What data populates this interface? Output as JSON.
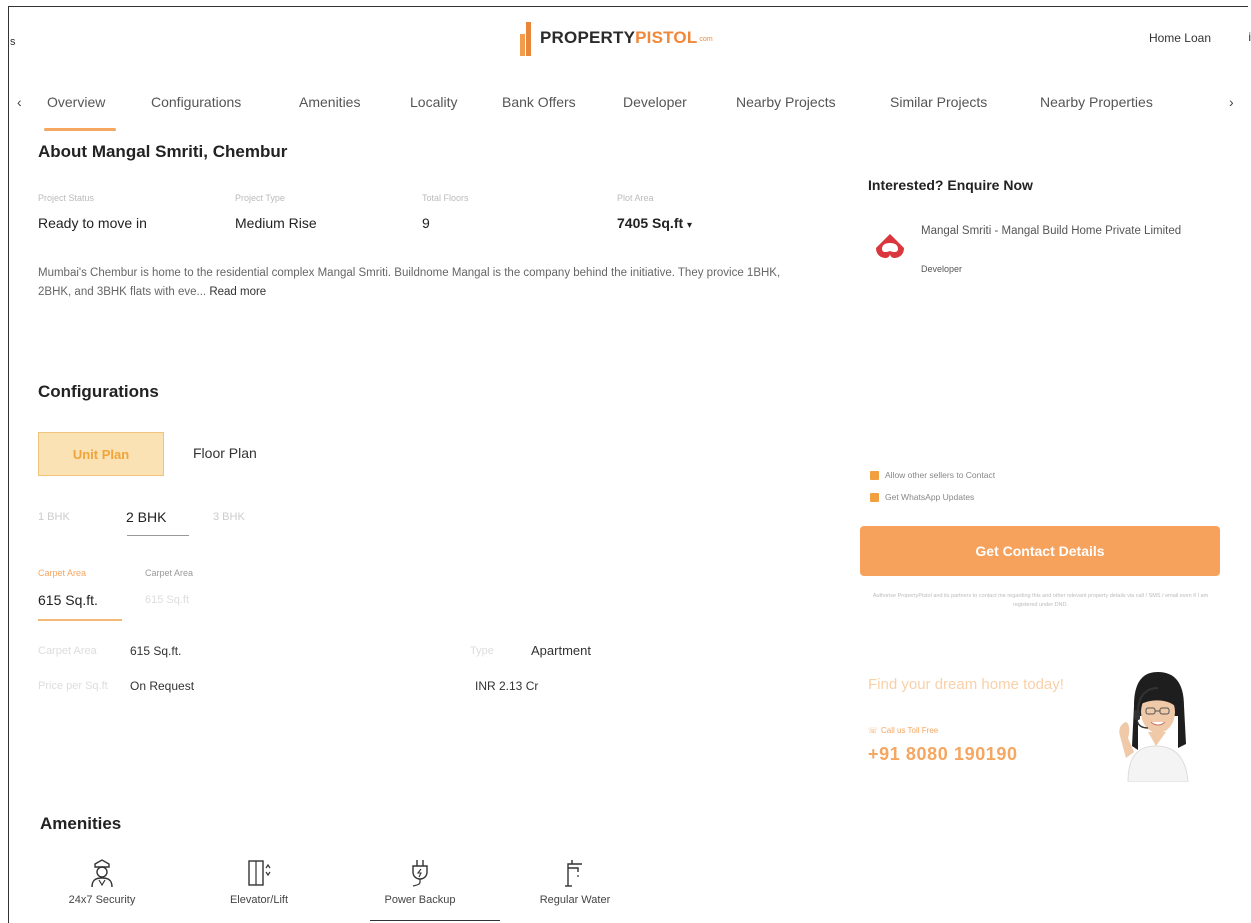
{
  "header": {
    "logo_part1": "PROPERTY",
    "logo_part2": "PISTOL",
    "logo_suffix": "com",
    "home_loan": "Home Loan",
    "left_mark": "s",
    "right_mark": "i"
  },
  "nav": {
    "prev": "‹",
    "next": "›",
    "tabs": [
      "Overview",
      "Configurations",
      "Amenities",
      "Locality",
      "Bank Offers",
      "Developer",
      "Nearby Projects",
      "Similar Projects",
      "Nearby Properties"
    ]
  },
  "about": {
    "title": "About Mangal Smriti, Chembur",
    "stats": [
      {
        "label": "Project Status",
        "value": "Ready to move in"
      },
      {
        "label": "Project Type",
        "value": "Medium Rise"
      },
      {
        "label": "Total Floors",
        "value": "9"
      },
      {
        "label": "Plot Area",
        "value": "7405 Sq.ft"
      }
    ],
    "dropdown_caret": "▾",
    "description": "Mumbai's Chembur is home to the residential complex Mangal Smriti. Buildnome Mangal is the company behind the initiative. They provice 1BHK, 2BHK, and 3BHK flats with eve...",
    "read_more": "Read more"
  },
  "configurations": {
    "title": "Configurations",
    "plan_tabs": [
      "Unit Plan",
      "Floor Plan"
    ],
    "bhk_tabs": [
      "1 BHK",
      "2 BHK",
      "3 BHK"
    ],
    "area_labels": [
      "Carpet Area",
      "Carpet Area"
    ],
    "area_value": "615 Sq.ft.",
    "area_value_alt": "615 Sq.ft",
    "details": [
      {
        "label": "Carpet Area",
        "value": "615 Sq.ft."
      },
      {
        "label": "Type",
        "value": "Apartment"
      },
      {
        "label": "Price per Sq.ft",
        "value": "On Request"
      },
      {
        "label": "",
        "value": "INR 2.13 Cr"
      }
    ]
  },
  "amenities": {
    "title": "Amenities",
    "items": [
      {
        "label": "24x7 Security",
        "icon": "security-guard-icon"
      },
      {
        "label": "Elevator/Lift",
        "icon": "elevator-icon"
      },
      {
        "label": "Power Backup",
        "icon": "power-plug-icon"
      },
      {
        "label": "Regular Water",
        "icon": "water-tap-icon"
      }
    ]
  },
  "enquiry": {
    "title": "Interested? Enquire Now",
    "developer_name": "Mangal Smriti - Mangal Build Home Private Limited",
    "developer_role": "Developer",
    "check_allow": "Allow other sellers to Contact",
    "check_whatsapp": "Get WhatsApp Updates",
    "contact_button": "Get Contact Details",
    "fine_print": "Authorise PropertyPistol and its partners to contact me regarding this and other relevant property details via call / SMS / email even if I am registered under DND.",
    "dream": "Find your dream home today!",
    "call_free": "Call us Toll Free",
    "phone": "+91 8080 190190"
  },
  "colors": {
    "accent": "#f5a660",
    "button": "#f7a25c",
    "brand_dark": "#2a2a2a",
    "brand_orange": "#f0873a"
  }
}
